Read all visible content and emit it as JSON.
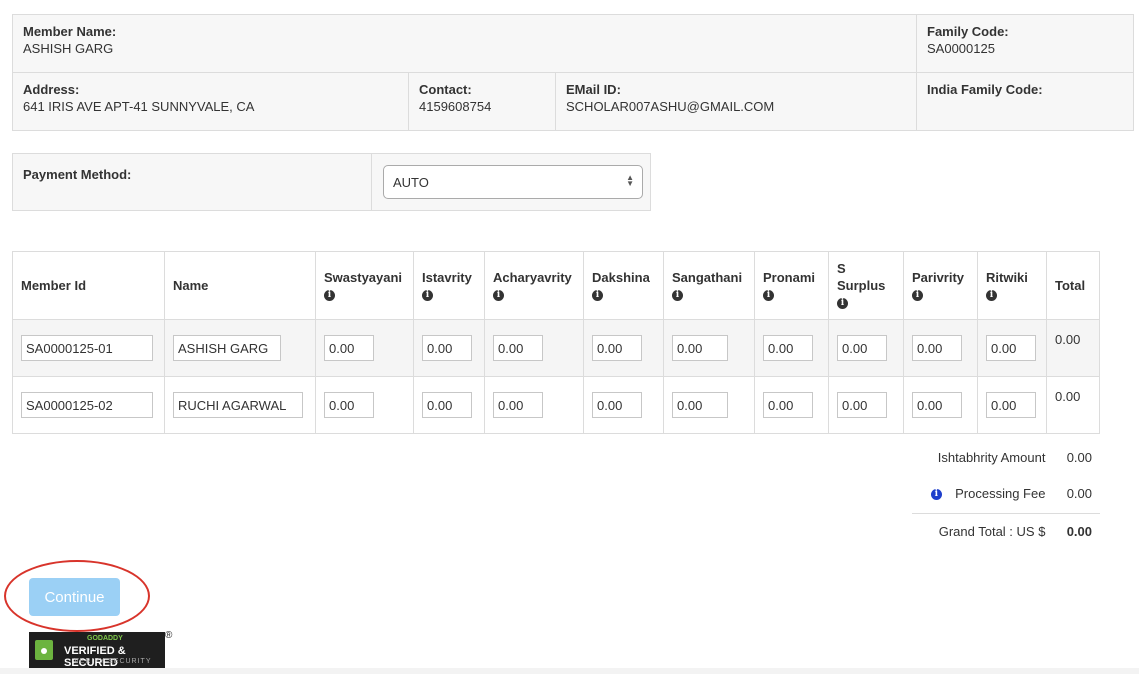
{
  "member": {
    "name_label": "Member Name:",
    "name": "ASHISH GARG",
    "family_code_label": "Family Code:",
    "family_code": "SA0000125",
    "address_label": "Address:",
    "address": "641 IRIS AVE APT-41 SUNNYVALE, CA",
    "contact_label": "Contact:",
    "contact": "4159608754",
    "email_label": "EMail ID:",
    "email": "SCHOLAR007ASHU@GMAIL.COM",
    "india_family_code_label": "India Family Code:",
    "india_family_code": ""
  },
  "payment": {
    "label": "Payment Method:",
    "selected": "AUTO"
  },
  "table": {
    "headers": {
      "member_id": "Member Id",
      "name": "Name",
      "swastyayani": "Swastyayani",
      "istavrity": "Istavrity",
      "acharyavrity": "Acharyavrity",
      "dakshina": "Dakshina",
      "sangathani": "Sangathani",
      "pronami": "Pronami",
      "s_surplus": "S Surplus",
      "parivrity": "Parivrity",
      "ritwiki": "Ritwiki",
      "total": "Total"
    },
    "rows": [
      {
        "member_id": "SA0000125-01",
        "name": "ASHISH GARG",
        "swastyayani": "0.00",
        "istavrity": "0.00",
        "acharyavrity": "0.00",
        "dakshina": "0.00",
        "sangathani": "0.00",
        "pronami": "0.00",
        "s_surplus": "0.00",
        "parivrity": "0.00",
        "ritwiki": "0.00",
        "total": "0.00"
      },
      {
        "member_id": "SA0000125-02",
        "name": "RUCHI AGARWAL",
        "swastyayani": "0.00",
        "istavrity": "0.00",
        "acharyavrity": "0.00",
        "dakshina": "0.00",
        "sangathani": "0.00",
        "pronami": "0.00",
        "s_surplus": "0.00",
        "parivrity": "0.00",
        "ritwiki": "0.00",
        "total": "0.00"
      }
    ]
  },
  "summary": {
    "ishtabhrity_label": "Ishtabhrity Amount",
    "ishtabhrity_value": "0.00",
    "processing_fee_label": "Processing Fee",
    "processing_fee_value": "0.00",
    "grand_total_label": "Grand Total : US $",
    "grand_total_value": "0.00"
  },
  "actions": {
    "continue_label": "Continue"
  },
  "seal": {
    "brand": "GODADDY",
    "title": "VERIFIED & SECURED",
    "subtitle": "VERIFY SECURITY",
    "reg": "®"
  },
  "colors": {
    "button": "#9bd0f5",
    "annotation_circle": "#d8342b",
    "info_icon_blue": "#1e3fcc",
    "panel_bg": "#f7f7f7"
  },
  "icons": {
    "header_info": "info-circle",
    "select_arrows": "up-down-caret",
    "seal_lock": "padlock"
  }
}
